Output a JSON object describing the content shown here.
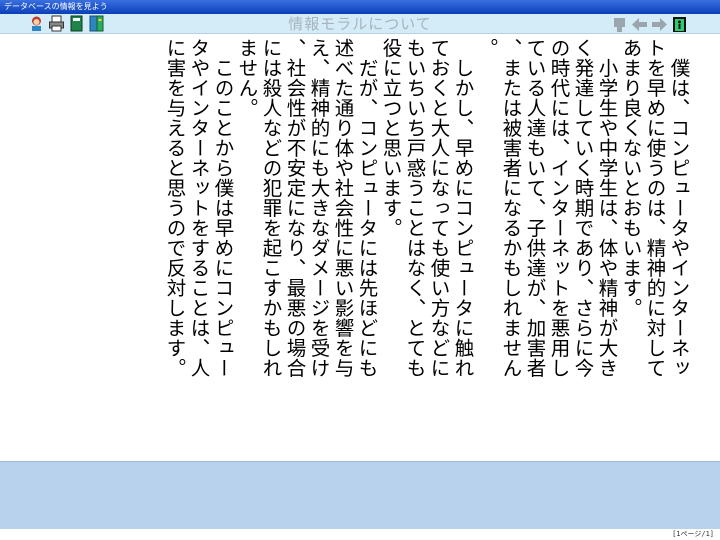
{
  "window": {
    "title": "データベースの情報を見よう"
  },
  "toolbar": {
    "document_title": "情報モラルについて",
    "left_icons": [
      "character-icon",
      "print-icon",
      "book-icon",
      "notebook-icon"
    ],
    "right_icons": [
      "bookmark-icon",
      "back-arrow-icon",
      "forward-arrow-icon",
      "exit-door-icon"
    ]
  },
  "article": {
    "paragraphs": [
      "　僕は、コンピュータやインターネットを早めに使うのは、精神的に対してあまり良くないとおもいます。",
      "　小学生や中学生は、体や精神が大きく発達していく時期であり、さらに今の時代には、インターネットを悪用している人達もいて、子供達が、加害者、または被害者になるかもしれません。",
      "　しかし、早めにコンピュータに触れておくと大人になっても使い方などにもいちいち戸惑うことはなく、とても役に立つと思います。",
      "　だが、コンピュータには先ほどにも述べた通り体や社会性に悪い影響を与え、精神的にも大きなダメージを受け、社会性が不安定になり、最悪の場合には殺人などの犯罪を起こすかもしれません。",
      "　このことから僕は早めにコンピュータやインターネットをすることは、人に害を与えると思うので反対します。"
    ]
  },
  "status": {
    "page_indicator": "[1ページ/1]"
  },
  "colors": {
    "toolbar_bg": "#d4ecf7",
    "bottom_panel_bg": "#b8d2ee",
    "title_text": "#a7b4bd"
  }
}
